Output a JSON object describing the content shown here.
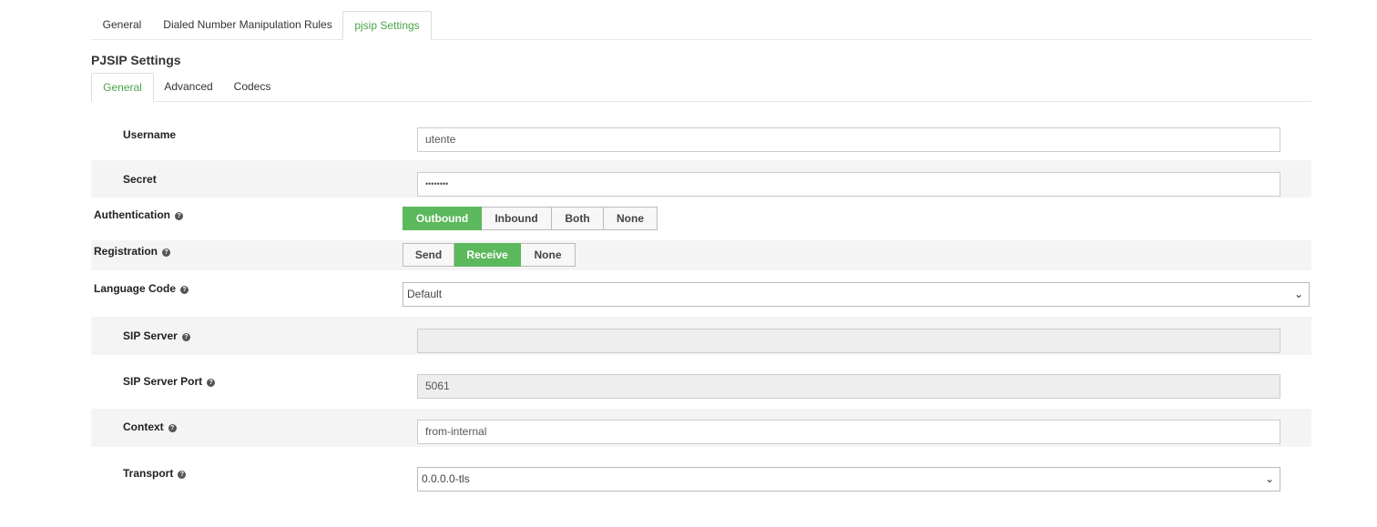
{
  "top_tabs": [
    "General",
    "Dialed Number Manipulation Rules",
    "pjsip Settings"
  ],
  "section_title": "PJSIP Settings",
  "sub_tabs": [
    "General",
    "Advanced",
    "Codecs"
  ],
  "fields": {
    "username": {
      "label": "Username",
      "value": "utente"
    },
    "secret": {
      "label": "Secret",
      "value": "••••••••"
    },
    "authentication": {
      "label": "Authentication",
      "options": [
        "Outbound",
        "Inbound",
        "Both",
        "None"
      ],
      "selected": "Outbound"
    },
    "registration": {
      "label": "Registration",
      "options": [
        "Send",
        "Receive",
        "None"
      ],
      "selected": "Receive"
    },
    "language_code": {
      "label": "Language Code",
      "value": "Default"
    },
    "sip_server": {
      "label": "SIP Server",
      "value": ""
    },
    "sip_server_port": {
      "label": "SIP Server Port",
      "value": "5061"
    },
    "context": {
      "label": "Context",
      "value": "from-internal"
    },
    "transport": {
      "label": "Transport",
      "value": "0.0.0.0-tls"
    }
  },
  "colors": {
    "accent": "#4aa54a",
    "button_active": "#5cb85c",
    "row_shade": "#f4f4f4"
  },
  "icons": {
    "help": "question-circle-icon",
    "dropdown": "chevron-down-icon"
  }
}
